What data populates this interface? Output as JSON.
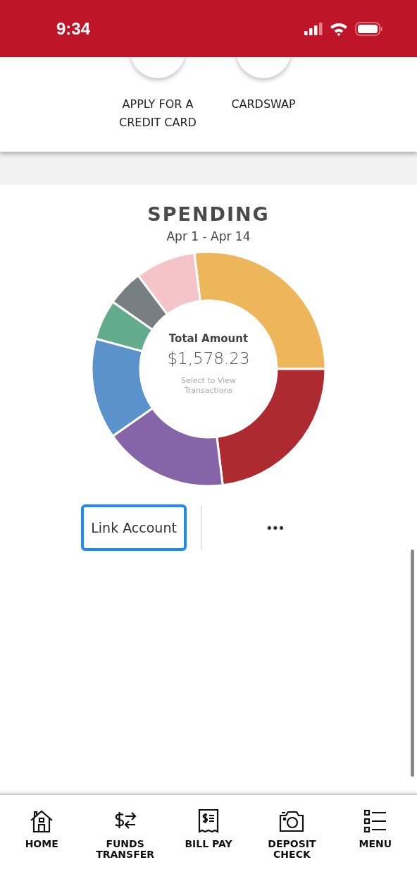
{
  "status_bar": {
    "time": "9:34"
  },
  "quick_actions": [
    {
      "label": "APPLY FOR A CREDIT CARD"
    },
    {
      "label": "CARDSWAP"
    }
  ],
  "spending": {
    "title": "SPENDING",
    "date_range": "Apr 1 - Apr 14",
    "center_label": "Total Amount",
    "total": "$1,578.23",
    "hint": "Select to View Transactions",
    "link_button": "Link Account",
    "more_button": "•••"
  },
  "bottom_nav": [
    {
      "kind": "home",
      "label": "HOME"
    },
    {
      "kind": "transfer",
      "label": "FUNDS TRANSFER"
    },
    {
      "kind": "bill",
      "label": "BILL PAY"
    },
    {
      "kind": "deposit",
      "label": "DEPOSIT CHECK"
    },
    {
      "kind": "menu",
      "label": "MENU"
    }
  ]
}
